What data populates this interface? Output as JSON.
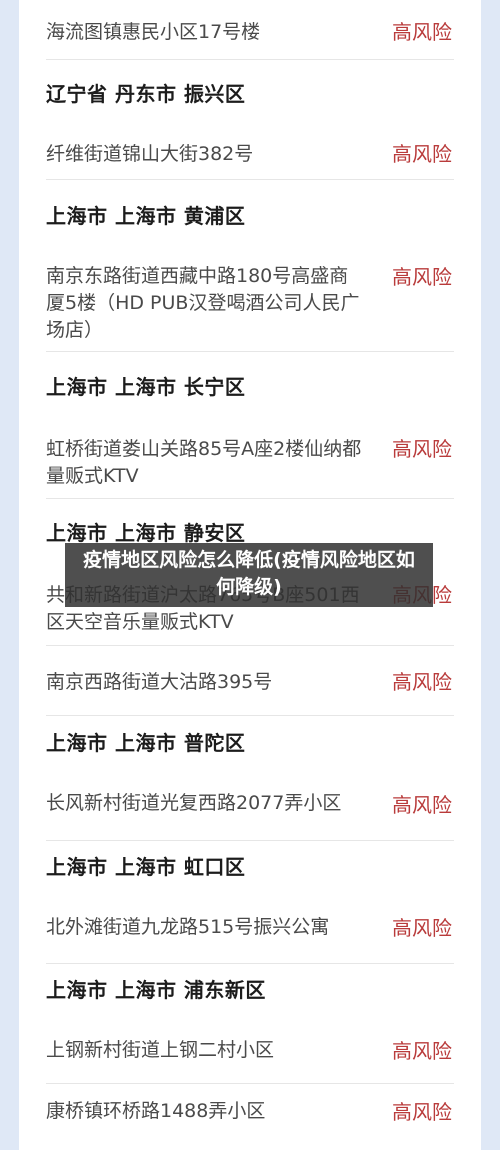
{
  "risk_list": {
    "rows": [
      {
        "type": "location",
        "address": "海流图镇惠民小区17号楼",
        "risk": "高风险"
      },
      {
        "type": "header",
        "text": "辽宁省 丹东市 振兴区"
      },
      {
        "type": "location",
        "address": "纤维街道锦山大街382号",
        "risk": "高风险"
      },
      {
        "type": "header",
        "text": "上海市 上海市 黄浦区"
      },
      {
        "type": "location",
        "address": "南京东路街道西藏中路180号高盛商厦5楼（HD PUB汉登喝酒公司人民广场店）",
        "risk": "高风险"
      },
      {
        "type": "header",
        "text": "上海市 上海市 长宁区"
      },
      {
        "type": "location",
        "address": "虹桥街道娄山关路85号A座2楼仙纳都量贩式KTV",
        "risk": "高风险"
      },
      {
        "type": "header",
        "text": "上海市 上海市 静安区"
      },
      {
        "type": "location",
        "address": "共和新路街道沪太路765号B座501西区天空音乐量贩式KTV",
        "risk": "高风险"
      },
      {
        "type": "location",
        "address": "南京西路街道大沽路395号",
        "risk": "高风险"
      },
      {
        "type": "header",
        "text": "上海市 上海市 普陀区"
      },
      {
        "type": "location",
        "address": "长风新村街道光复西路2077弄小区",
        "risk": "高风险"
      },
      {
        "type": "header",
        "text": "上海市 上海市 虹口区"
      },
      {
        "type": "location",
        "address": "北外滩街道九龙路515号振兴公寓",
        "risk": "高风险"
      },
      {
        "type": "header",
        "text": "上海市 上海市 浦东新区"
      },
      {
        "type": "location",
        "address": "上钢新村街道上钢二村小区",
        "risk": "高风险"
      },
      {
        "type": "location",
        "address": "康桥镇环桥路1488弄小区",
        "risk": "高风险"
      }
    ]
  },
  "overlay": {
    "title": "疫情地区风险怎么降低(疫情风险地区如何降级)"
  }
}
